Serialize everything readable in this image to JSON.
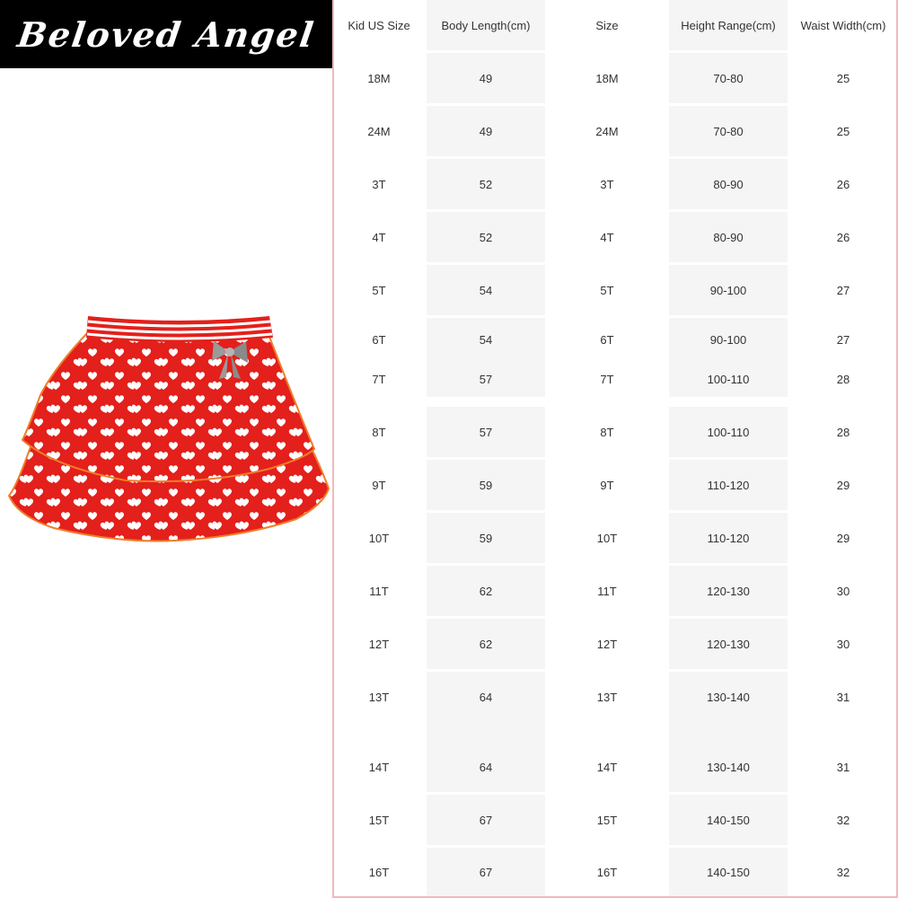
{
  "brand": {
    "logo_text": "Beloved Angel"
  },
  "product": {
    "image_label": "red-heart-tiered-skirt"
  },
  "colors": {
    "accent_border": "#f2b9b9",
    "skirt_red": "#e3201b",
    "row_shade": "#f5f5f5"
  },
  "size_table": {
    "headers": [
      "Kid US Size",
      "Body Length(cm)",
      "Size",
      "Height Range(cm)",
      "Waist Width(cm)"
    ],
    "rows": [
      [
        "18M",
        "49",
        "18M",
        "70-80",
        "25"
      ],
      [
        "24M",
        "49",
        "24M",
        "70-80",
        "25"
      ],
      [
        "3T",
        "52",
        "3T",
        "80-90",
        "26"
      ],
      [
        "4T",
        "52",
        "4T",
        "80-90",
        "26"
      ],
      [
        "5T",
        "54",
        "5T",
        "90-100",
        "27"
      ],
      [
        "6T",
        "54",
        "6T",
        "90-100",
        "27"
      ],
      [
        "7T",
        "57",
        "7T",
        "100-110",
        "28"
      ],
      [
        "8T",
        "57",
        "8T",
        "100-110",
        "28"
      ],
      [
        "9T",
        "59",
        "9T",
        "110-120",
        "29"
      ],
      [
        "10T",
        "59",
        "10T",
        "110-120",
        "29"
      ],
      [
        "11T",
        "62",
        "11T",
        "120-130",
        "30"
      ],
      [
        "12T",
        "62",
        "12T",
        "120-130",
        "30"
      ],
      [
        "13T",
        "64",
        "13T",
        "130-140",
        "31"
      ],
      [
        "14T",
        "64",
        "14T",
        "130-140",
        "31"
      ],
      [
        "15T",
        "67",
        "15T",
        "140-150",
        "32"
      ],
      [
        "16T",
        "67",
        "16T",
        "140-150",
        "32"
      ]
    ]
  }
}
